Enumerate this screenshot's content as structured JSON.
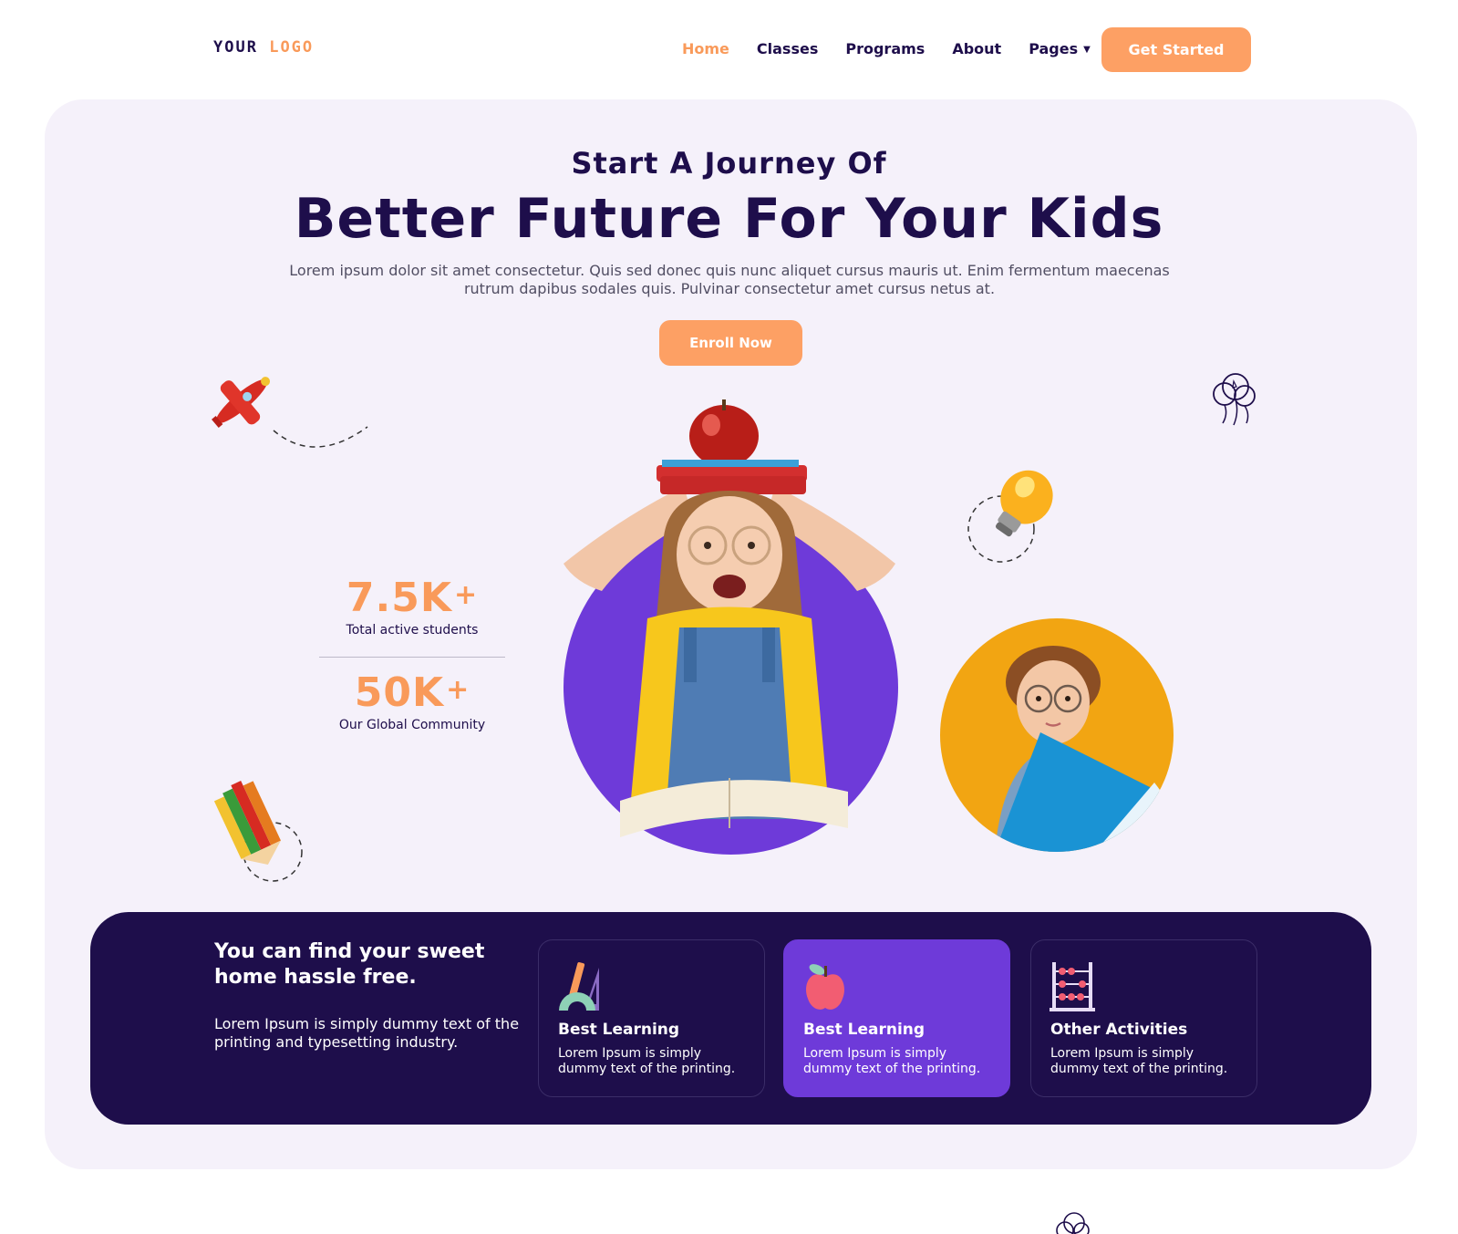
{
  "header": {
    "logo": {
      "text1": "YOUR",
      "text2": "LOGO"
    },
    "nav": [
      {
        "label": "Home",
        "active": true
      },
      {
        "label": "Classes"
      },
      {
        "label": "Programs"
      },
      {
        "label": "About"
      },
      {
        "label": "Pages",
        "dropdown": true
      }
    ],
    "cta": "Get Started"
  },
  "hero": {
    "eyebrow": "Start A Journey Of",
    "headline": "Better Future For Your Kids",
    "subtext": "Lorem ipsum dolor sit amet consectetur. Quis sed donec quis nunc aliquet cursus mauris ut. Enim fermentum maecenas rutrum dapibus sodales quis. Pulvinar consectetur amet cursus netus at.",
    "cta": "Enroll Now"
  },
  "stats": [
    {
      "value": "7.5K",
      "suffix": "+",
      "label": "Total active students"
    },
    {
      "value": "50K",
      "suffix": "+",
      "label": "Our Global Community"
    }
  ],
  "features": {
    "title": "You can find your sweet home hassle free.",
    "text": "Lorem Ipsum is simply dummy text of the printing and typesetting industry.",
    "cards": [
      {
        "icon": "geometry-tools-icon",
        "title": "Best Learning",
        "text": "Lorem Ipsum is simply dummy text of the printing."
      },
      {
        "icon": "apple-icon",
        "title": "Best Learning",
        "text": "Lorem Ipsum is simply dummy text of the printing.",
        "highlighted": true
      },
      {
        "icon": "abacus-icon",
        "title": "Other Activities",
        "text": "Lorem Ipsum is simply dummy text of the printing."
      }
    ]
  },
  "colors": {
    "accent": "#fda064",
    "navy": "#1e0e4b",
    "purple": "#6e3ad9",
    "hero_bg": "#f5f1fa",
    "yellow": "#f2a512"
  }
}
